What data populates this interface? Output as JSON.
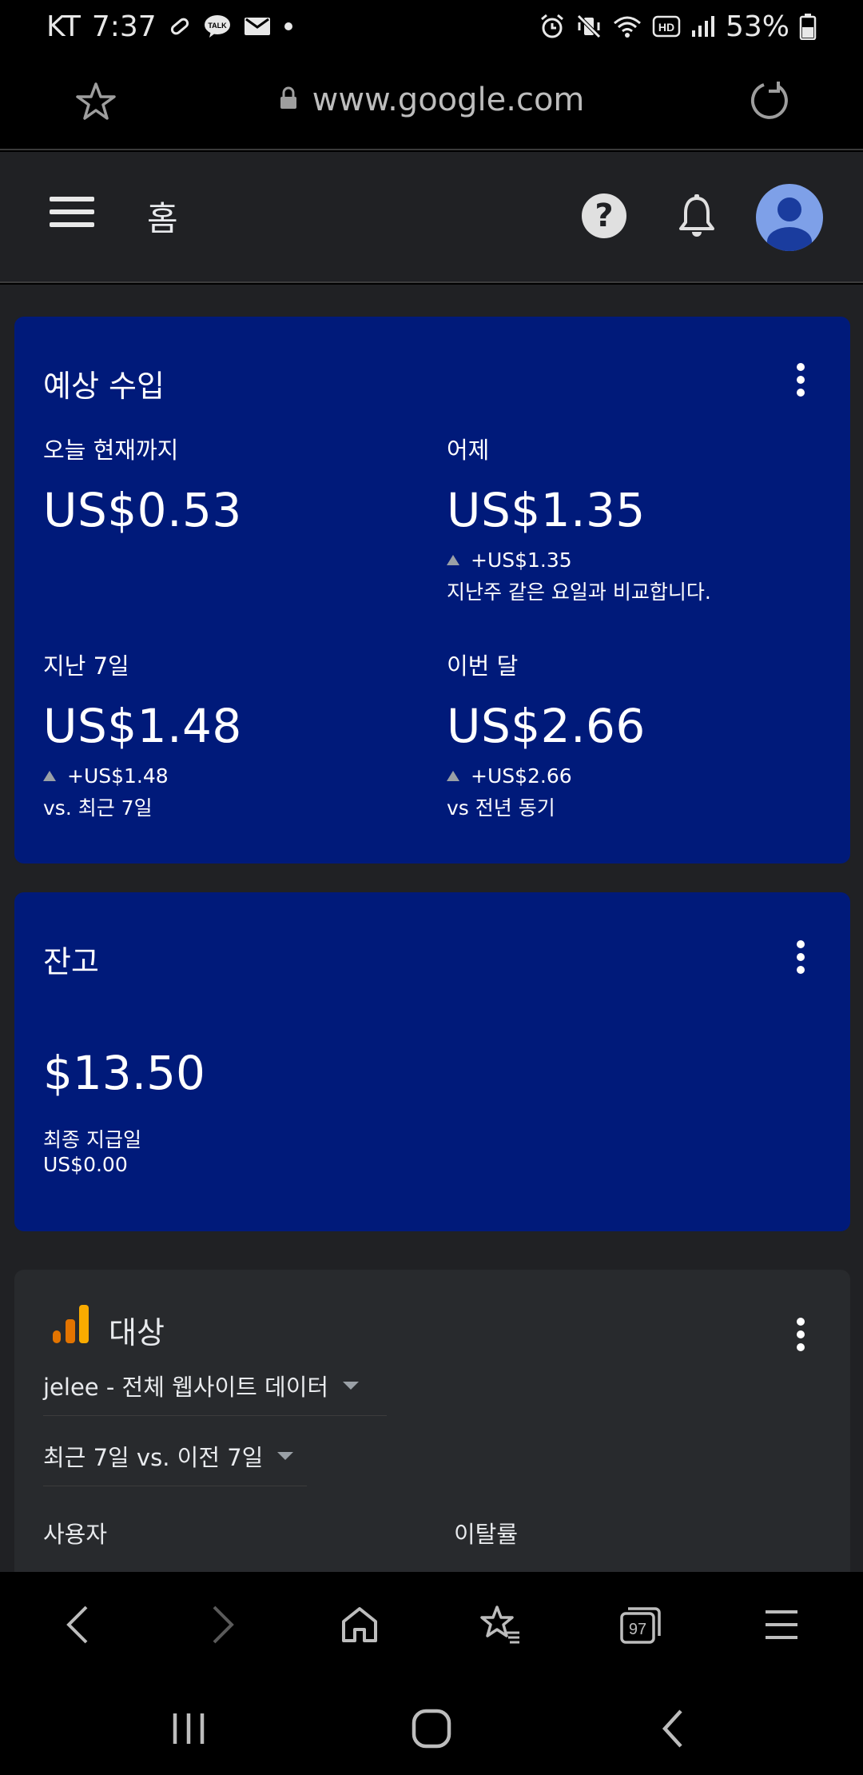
{
  "status_bar": {
    "carrier": "KT",
    "time": "7:37",
    "talk_badge": "TALK",
    "hd_badge": "HD",
    "battery": "53%"
  },
  "browser": {
    "url": "www.google.com",
    "tabs_count": "97"
  },
  "header": {
    "title": "홈"
  },
  "earnings": {
    "title": "예상 수입",
    "today": {
      "label": "오늘 현재까지",
      "value": "US$0.53"
    },
    "yesterday": {
      "label": "어제",
      "value": "US$1.35",
      "delta": "+US$1.35",
      "note": "지난주 같은 요일과 비교합니다."
    },
    "last7": {
      "label": "지난 7일",
      "value": "US$1.48",
      "delta": "+US$1.48",
      "note": "vs. 최근 7일"
    },
    "month": {
      "label": "이번 달",
      "value": "US$2.66",
      "delta": "+US$2.66",
      "note": "vs 전년 동기"
    }
  },
  "balance": {
    "title": "잔고",
    "value": "$13.50",
    "last_payment_label": "최종 지급일",
    "last_payment_value": "US$0.00"
  },
  "audience": {
    "title": "대상",
    "property": "jelee - 전체 웹사이트 데이터",
    "range": "최근 7일 vs. 이전 7일",
    "users_label": "사용자",
    "bounce_label": "이탈률"
  },
  "colors": {
    "card_blue": "#001a7a",
    "page_bg": "#202124",
    "analytics_orange": "#f9ab00",
    "analytics_dark_orange": "#e37400"
  }
}
